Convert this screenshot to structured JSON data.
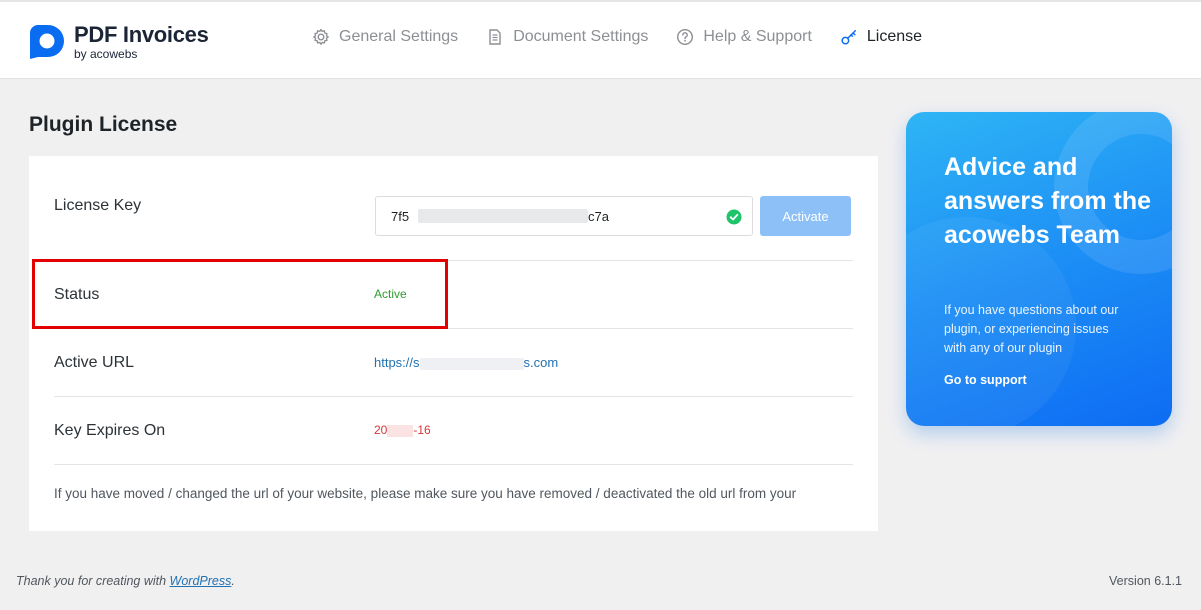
{
  "brand": {
    "title": "PDF Invoices",
    "subtitle": "by acowebs",
    "color": "#0a6cf0"
  },
  "nav": {
    "items": [
      {
        "label": "General Settings",
        "icon": "gear-icon",
        "active": false
      },
      {
        "label": "Document Settings",
        "icon": "document-icon",
        "active": false
      },
      {
        "label": "Help & Support",
        "icon": "question-circle-icon",
        "active": false
      },
      {
        "label": "License",
        "icon": "key-icon",
        "active": true
      }
    ]
  },
  "page": {
    "title": "Plugin License"
  },
  "license": {
    "key_label": "License Key",
    "key_value_start": "7f5",
    "key_value_end": "c7a",
    "activate_label": "Activate",
    "status_label": "Status",
    "status_value": "Active",
    "url_label": "Active URL",
    "url_value_start": "https://s",
    "url_value_end": "s.com",
    "expires_label": "Key Expires On",
    "expires_value_start": "20",
    "expires_value_end": "-16",
    "note": "If you have moved / changed the url of your website, please make sure you have removed / deactivated the old url from your"
  },
  "support": {
    "title": "Advice and answers from the acowebs Team",
    "description": "If you have questions about our plugin, or experiencing issues with any of our plugin",
    "link_label": "Go to support"
  },
  "footer": {
    "thanks_prefix": "Thank you for creating with ",
    "thanks_link": "WordPress",
    "thanks_suffix": ".",
    "version": "Version 6.1.1"
  },
  "colors": {
    "status_active": "#2e9c2e",
    "expires": "#d63638",
    "link": "#2271b1",
    "highlight": "#e20000",
    "activate_button": "#8ec0f8"
  }
}
